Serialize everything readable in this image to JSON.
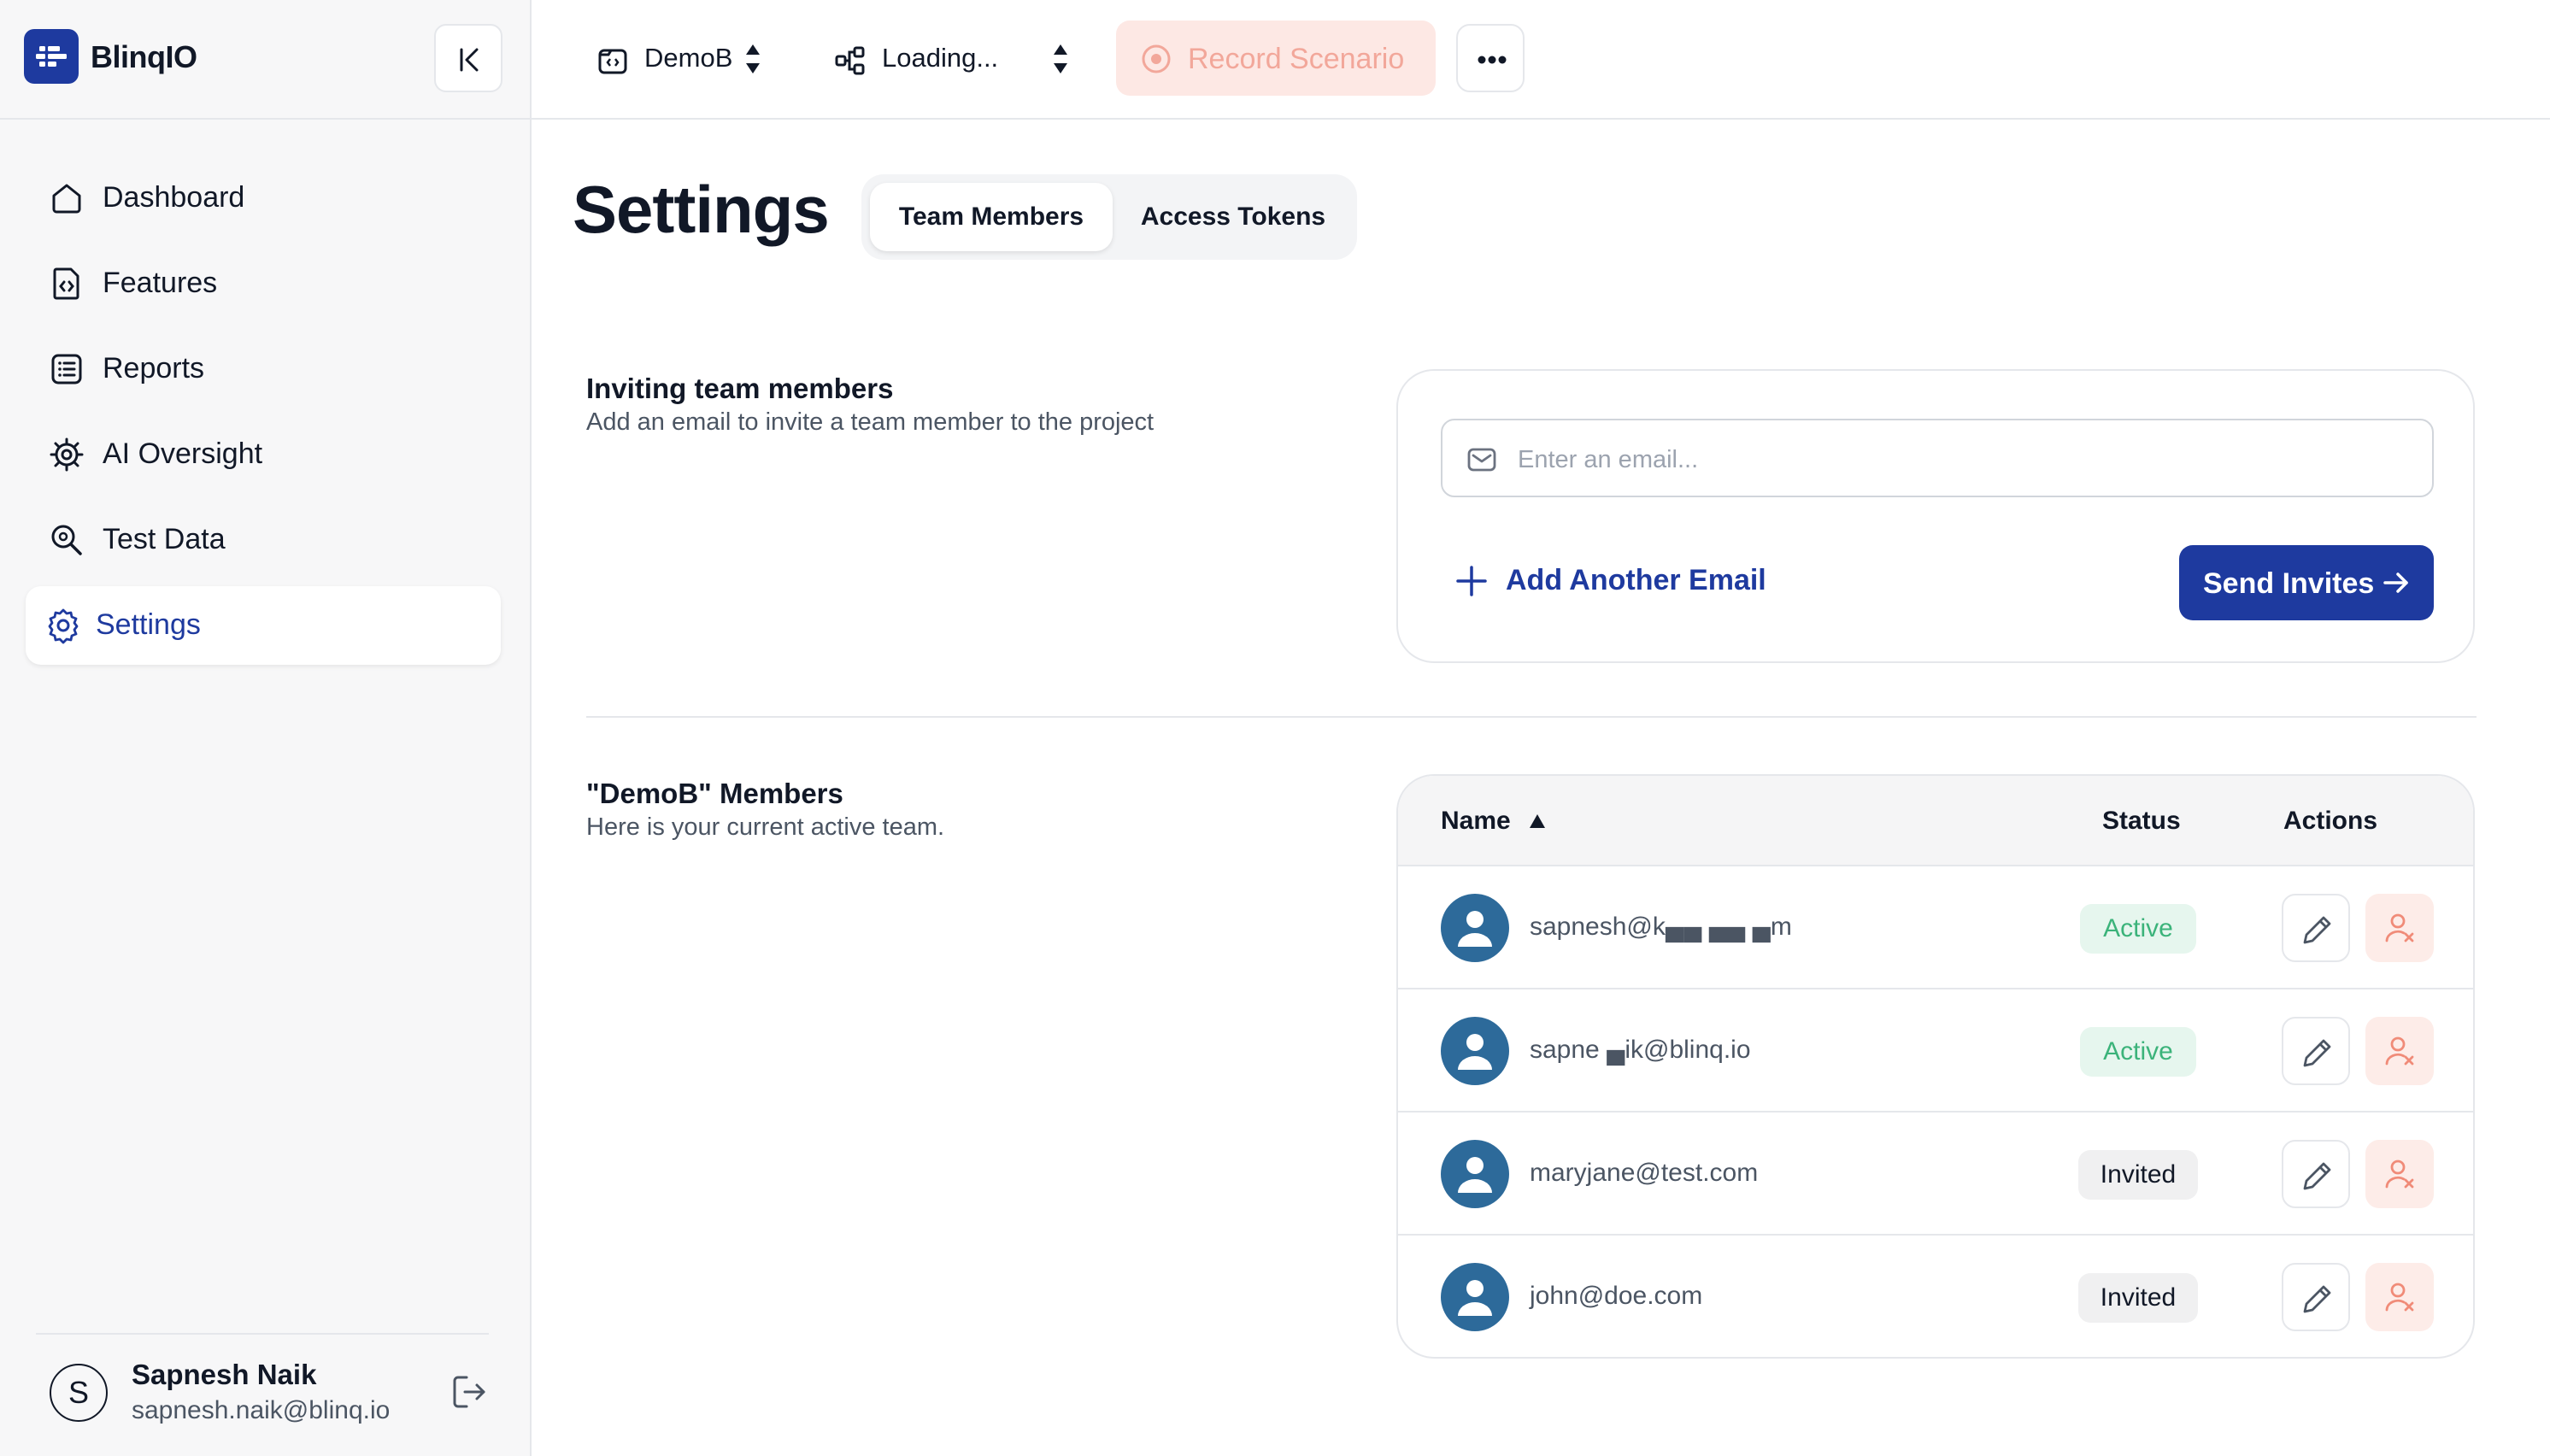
{
  "brand": {
    "name": "BlinqIO"
  },
  "sidebar": {
    "items": [
      {
        "label": "Dashboard",
        "icon": "home-icon"
      },
      {
        "label": "Features",
        "icon": "file-code-icon"
      },
      {
        "label": "Reports",
        "icon": "list-report-icon"
      },
      {
        "label": "AI Oversight",
        "icon": "gear-chip-icon"
      },
      {
        "label": "Test Data",
        "icon": "search-data-icon"
      },
      {
        "label": "Settings",
        "icon": "settings-gear-icon",
        "active": true
      }
    ]
  },
  "user": {
    "initial": "S",
    "name": "Sapnesh Naik",
    "email": "sapnesh.naik@blinq.io"
  },
  "topbar": {
    "project": "DemoB",
    "environment": "Loading...",
    "record_label": "Record Scenario"
  },
  "page": {
    "title": "Settings",
    "tabs": [
      "Team Members",
      "Access Tokens"
    ],
    "active_tab": "Team Members"
  },
  "invite": {
    "title": "Inviting team members",
    "subtitle": "Add an email to invite a team member to the project",
    "email_placeholder": "Enter an email...",
    "add_label": "Add Another Email",
    "send_label": "Send Invites"
  },
  "members": {
    "title": "\"DemoB\" Members",
    "subtitle": "Here is your current active team.",
    "columns": {
      "name": "Name",
      "status": "Status",
      "actions": "Actions"
    },
    "rows": [
      {
        "email": "sapnesh@k▄▄  ▄▄  ▄m",
        "status": "Active"
      },
      {
        "email": "sapne    ▄ik@blinq.io",
        "status": "Active"
      },
      {
        "email": "maryjane@test.com",
        "status": "Invited"
      },
      {
        "email": "john@doe.com",
        "status": "Invited"
      }
    ]
  },
  "colors": {
    "brand_blue": "#1e3a9f",
    "active_green": "#3bb37a",
    "record_pink": "#fde8e4"
  }
}
